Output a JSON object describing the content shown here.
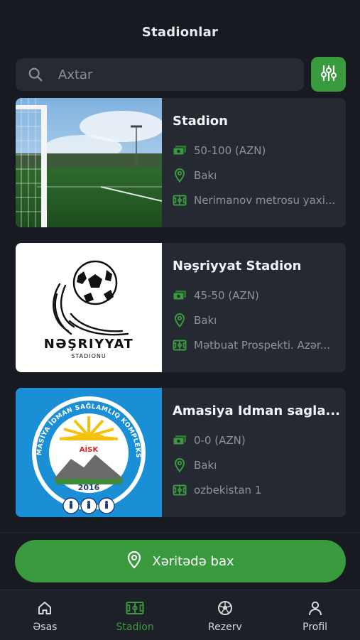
{
  "header": {
    "title": "Stadionlar"
  },
  "search": {
    "placeholder": "Axtar"
  },
  "colors": {
    "accent": "#3a9a3e",
    "background": "#171a21",
    "card": "#252932"
  },
  "stadiums": [
    {
      "name": "Stadion",
      "price": "50-100 (AZN)",
      "city": "Bakı",
      "address": "Nerimanov metrosu yaxi..."
    },
    {
      "name": "Nəşriyyat Stadion",
      "price": "45-50 (AZN)",
      "city": "Bakı",
      "address": "Mətbuat Prospekti. Azər...",
      "logo": {
        "line1": "NƏŞRIYYAT",
        "line2": "STADIONU"
      }
    },
    {
      "name": "Amasiya Idman sagla...",
      "price": "0-0 (AZN)",
      "city": "Bakı",
      "address": "ozbekistan 1",
      "logo": {
        "arc": "AMASİYA İDMAN SAĞLAMLIQ KOMPLEKSİ",
        "abbr": "AİSK",
        "year": "2016"
      }
    }
  ],
  "map_button": {
    "label": "Xəritədə bax"
  },
  "nav": [
    {
      "label": "Əsas",
      "icon": "home-icon"
    },
    {
      "label": "Stadion",
      "icon": "stadium-icon",
      "active": true
    },
    {
      "label": "Rezerv",
      "icon": "soccer-ball-icon"
    },
    {
      "label": "Profil",
      "icon": "user-icon"
    }
  ]
}
